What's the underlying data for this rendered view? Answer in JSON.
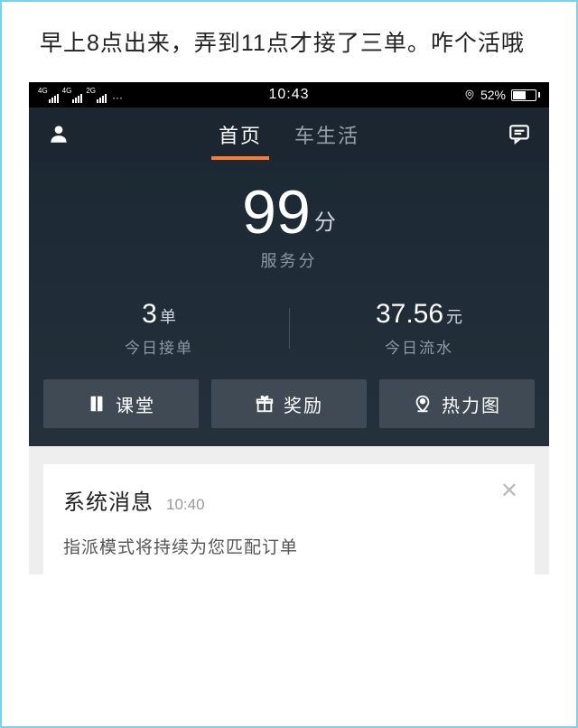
{
  "caption": "早上8点出来，弄到11点才接了三单。咋个活哦",
  "status": {
    "net_labels": [
      "4G",
      "4G",
      "2G"
    ],
    "dots": "···",
    "time": "10:43",
    "battery_pct": "52%"
  },
  "nav": {
    "tab_home": "首页",
    "tab_carlife": "车生活"
  },
  "score": {
    "value": "99",
    "unit": "分",
    "label": "服务分"
  },
  "stats": {
    "orders_value": "3",
    "orders_unit": "单",
    "orders_label": "今日接单",
    "revenue_value": "37.56",
    "revenue_unit": "元",
    "revenue_label": "今日流水"
  },
  "actions": {
    "class": "课堂",
    "reward": "奖励",
    "heatmap": "热力图"
  },
  "message": {
    "title": "系统消息",
    "time": "10:40",
    "body": "指派模式将持续为您匹配订单"
  }
}
